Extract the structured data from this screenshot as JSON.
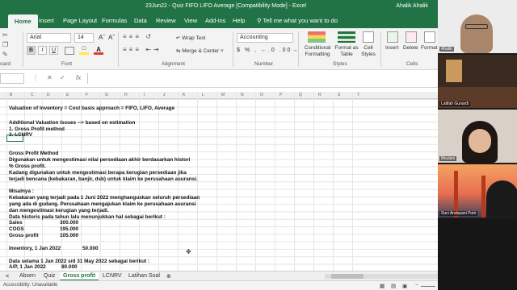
{
  "window": {
    "title": "23Jun22 - Quiz FIFO LIFO Average  [Compatibility Mode]  -  Excel",
    "user": "Ahalik Ahalik"
  },
  "ribbon_tabs": [
    "Home",
    "Insert",
    "Page Layout",
    "Formulas",
    "Data",
    "Review",
    "View",
    "Add-ins",
    "Help"
  ],
  "tell_me": "Tell me what you want to do",
  "ribbon": {
    "font_name": "Arial",
    "font_size": "14",
    "bold": "B",
    "italic": "I",
    "underline": "U",
    "wrap_text": "Wrap Text",
    "merge_center": "Merge & Center",
    "number_format": "Accounting",
    "conditional_formatting": "Conditional Formatting",
    "format_as_table": "Format as Table",
    "cell_styles": "Cell Styles",
    "insert": "Insert",
    "delete": "Delete",
    "format": "Format",
    "groups": {
      "clipboard": "oard",
      "font": "Font",
      "alignment": "Alignment",
      "number": "Number",
      "styles": "Styles",
      "cells": "Cells"
    },
    "accent": "#217346"
  },
  "formula_bar": {
    "name_box": "",
    "fx": "fx",
    "content": ""
  },
  "columns": [
    "B",
    "C",
    "D",
    "E",
    "F",
    "G",
    "H",
    "I",
    "J",
    "K",
    "L",
    "M",
    "N",
    "O",
    "P",
    "Q",
    "R",
    "S",
    "T"
  ],
  "sheet_lines": [
    "Valuation of Inventory = Cost basis approach = FIFO, LIFO, Average",
    "",
    "Additional Valuation Issues --> based on estimation",
    "1. Gross Profit method",
    "2. LCNRV",
    "",
    "",
    "Gross Profit Method",
    "Digunakan untuk mengestimasi nilai persediaan akhir berdasarkan histori",
    "% Gross profit.",
    "Kadang digunakan untuk mengestimasi berapa kerugian persediaan jika",
    "terjadi bencana (kebakaran, banjir, dsb) untuk klaim ke perusahaan asuransi.",
    "",
    "Misalnya :",
    "Kebakaran yang terjadi pada 1 Juni 2022 menghanguskan seluruh persediaan",
    "yang ada di gudang. Perusahaan mengajukan klaim ke perusahaan asuransi",
    "dan mengestimasi kerugian yang terjadi.",
    "Data historis pada tahun lalu menunjukkan hal sebagai berikut :"
  ],
  "history_table": [
    {
      "label": "Sales",
      "value": "300.000"
    },
    {
      "label": "COGS",
      "value": "195.000"
    },
    {
      "label": "Gross profit",
      "value": "105.000"
    }
  ],
  "inventory_line": {
    "label": "Inventory, 1 Jan 2022",
    "value": "50.000"
  },
  "data_line": "Data selama 1 Jan 2022 s/d 31 May 2022 sebagai berikut :",
  "ap_line": {
    "label": "A/P, 1 Jan 2022",
    "value": "80.000"
  },
  "sheet_tabs": [
    "Absen",
    "Quiz",
    "Gross profit",
    "LCNRV",
    "Latihan Soal"
  ],
  "active_sheet": "Gross profit",
  "status": {
    "accessibility": "Accessibility: Unavailable"
  },
  "participants": [
    {
      "name": "Ahalik"
    },
    {
      "name": "Latifah Gunardi"
    },
    {
      "name": "Meylani"
    },
    {
      "name": "Suci Andayani Putri"
    }
  ]
}
